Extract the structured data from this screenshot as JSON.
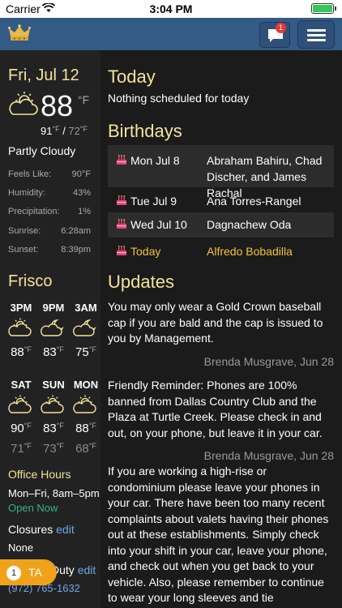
{
  "status_bar": {
    "carrier": "Carrier",
    "time": "3:04 PM"
  },
  "nav": {
    "message_badge": "1"
  },
  "weather": {
    "date": "Fri, Jul 12",
    "temp": "88",
    "temp_unit": "°F",
    "high": "91",
    "low": "72",
    "deg_unit": "°F",
    "condition": "Partly Cloudy",
    "stats": [
      {
        "label": "Feels Like:",
        "value": "90°F"
      },
      {
        "label": "Humidity:",
        "value": "43%"
      },
      {
        "label": "Precipitation:",
        "value": "1%"
      },
      {
        "label": "Sunrise:",
        "value": "6:28am"
      },
      {
        "label": "Sunset:",
        "value": "8:39pm"
      }
    ]
  },
  "forecast": {
    "city": "Frisco",
    "hourly": [
      {
        "label": "3PM",
        "temp": "88",
        "icon": "partly-sunny-icon"
      },
      {
        "label": "9PM",
        "temp": "83",
        "icon": "cloudy-night-icon"
      },
      {
        "label": "3AM",
        "temp": "75",
        "icon": "cloudy-night-icon"
      }
    ],
    "daily": [
      {
        "label": "SAT",
        "hi": "90",
        "lo": "71"
      },
      {
        "label": "SUN",
        "hi": "83",
        "lo": "73"
      },
      {
        "label": "MON",
        "hi": "88",
        "lo": "68"
      }
    ],
    "deg": "°F"
  },
  "office": {
    "title": "Office Hours",
    "hours": "Mon–Fri, 8am–5pm",
    "status": "Open Now",
    "closures_title": "Closures",
    "closures_edit": "edit",
    "closures_value": "None",
    "duty_title": "Duty",
    "duty_edit": "edit",
    "phone": "(972) 765-1632"
  },
  "ta": {
    "count": "1",
    "label": "TA"
  },
  "today": {
    "title": "Today",
    "message": "Nothing scheduled for today"
  },
  "birthdays": {
    "title": "Birthdays",
    "items": [
      {
        "date": "Mon Jul 8",
        "names": "Abraham Bahiru, Chad Discher, and James Rachal"
      },
      {
        "date": "Tue Jul 9",
        "names": "Ana Torres-Rangel"
      },
      {
        "date": "Wed Jul 10",
        "names": "Dagnachew Oda"
      },
      {
        "date": "Today",
        "names": "Alfredo Bobadilla"
      }
    ]
  },
  "updates": {
    "title": "Updates",
    "items": [
      {
        "text": "You may only wear a Gold Crown baseball cap if you are bald and the cap is issued to you by Management.",
        "by": "Brenda Musgrave, Jun 28"
      },
      {
        "text": "Friendly Reminder: Phones are 100% banned from Dallas Country Club and the Plaza at Turtle Creek. Please check in and out, on your phone, but leave it in your car.",
        "by": "Brenda Musgrave, Jun 28"
      },
      {
        "text": "If you are working a high-rise or condominium please leave your phones in your car. There have been too many recent complaints about valets having their phones out at these establishments. Simply check into your shift in your car, leave your phone, and check out when you get back to your vehicle. Also, please remember to continue to wear your long sleeves and tie",
        "by": ""
      }
    ]
  },
  "colors": {
    "accent": "#f3e39b",
    "navbar": "#345a86",
    "link": "#6ea6e8",
    "open": "#35b37e",
    "today": "#f3c232",
    "cake": "#e0447a"
  }
}
